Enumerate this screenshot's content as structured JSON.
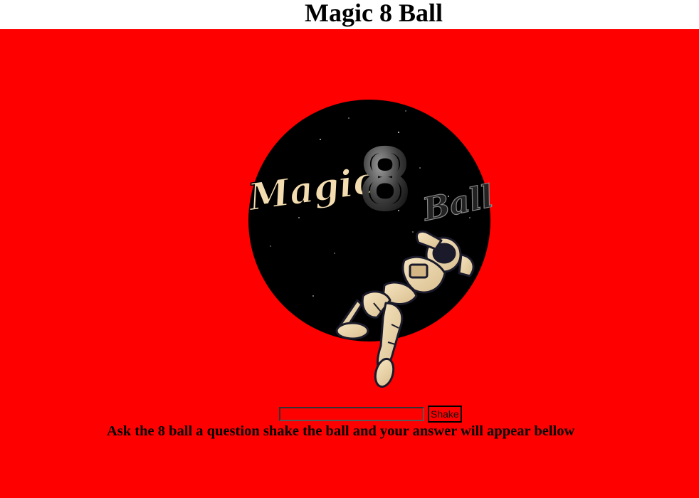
{
  "page": {
    "title": "Magic 8 Ball"
  },
  "logo": {
    "word_magic": "Magic",
    "numeral": "8",
    "word_ball": "Ball"
  },
  "form": {
    "question_value": "",
    "question_placeholder": "",
    "shake_label": "Shake"
  },
  "instructions": "Ask the 8 ball a question shake the ball and your answer will appear bellow",
  "colors": {
    "background": "#ff0000",
    "ball": "#000000",
    "logo_cream": "#f3dcb0",
    "header_bg": "#ffffff"
  }
}
